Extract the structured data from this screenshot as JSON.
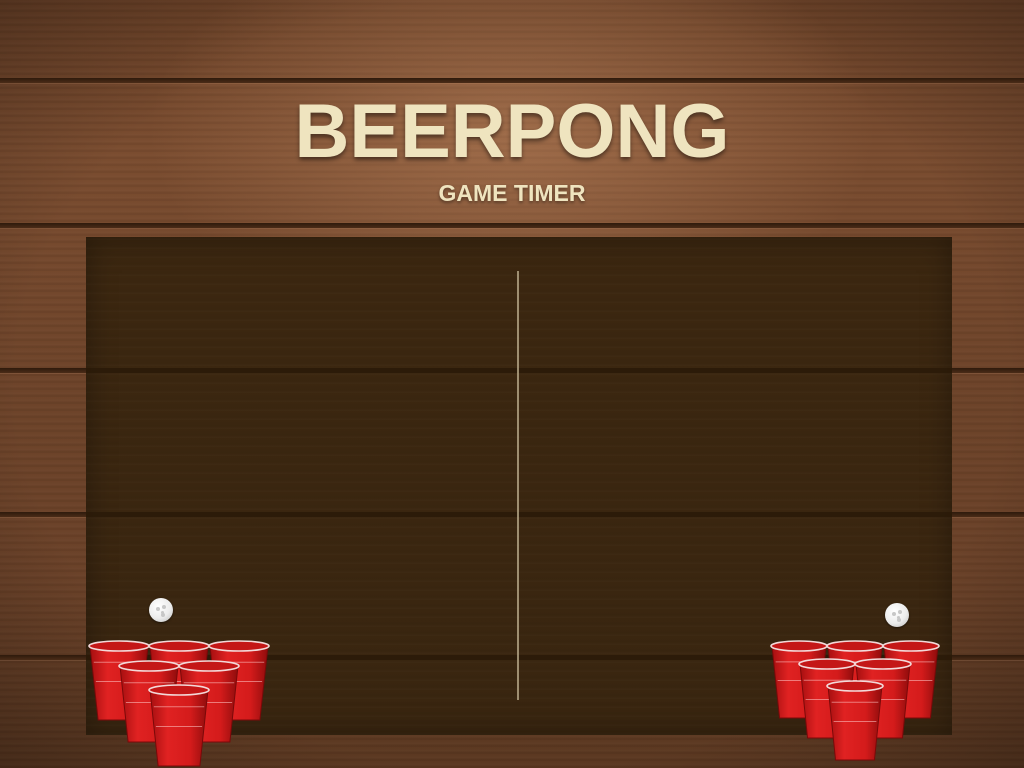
{
  "title": "BEERPONG",
  "subtitle": "GAME TIMER",
  "colors": {
    "title": "#efe4bf",
    "cup_red": "#d81c1c",
    "table": "#3b2610",
    "wood": "#6b4127"
  },
  "players": [
    {
      "side": "left",
      "cups": 6,
      "ball_icon": "ping-pong-ball-icon"
    },
    {
      "side": "right",
      "cups": 6,
      "ball_icon": "ping-pong-ball-icon"
    }
  ]
}
